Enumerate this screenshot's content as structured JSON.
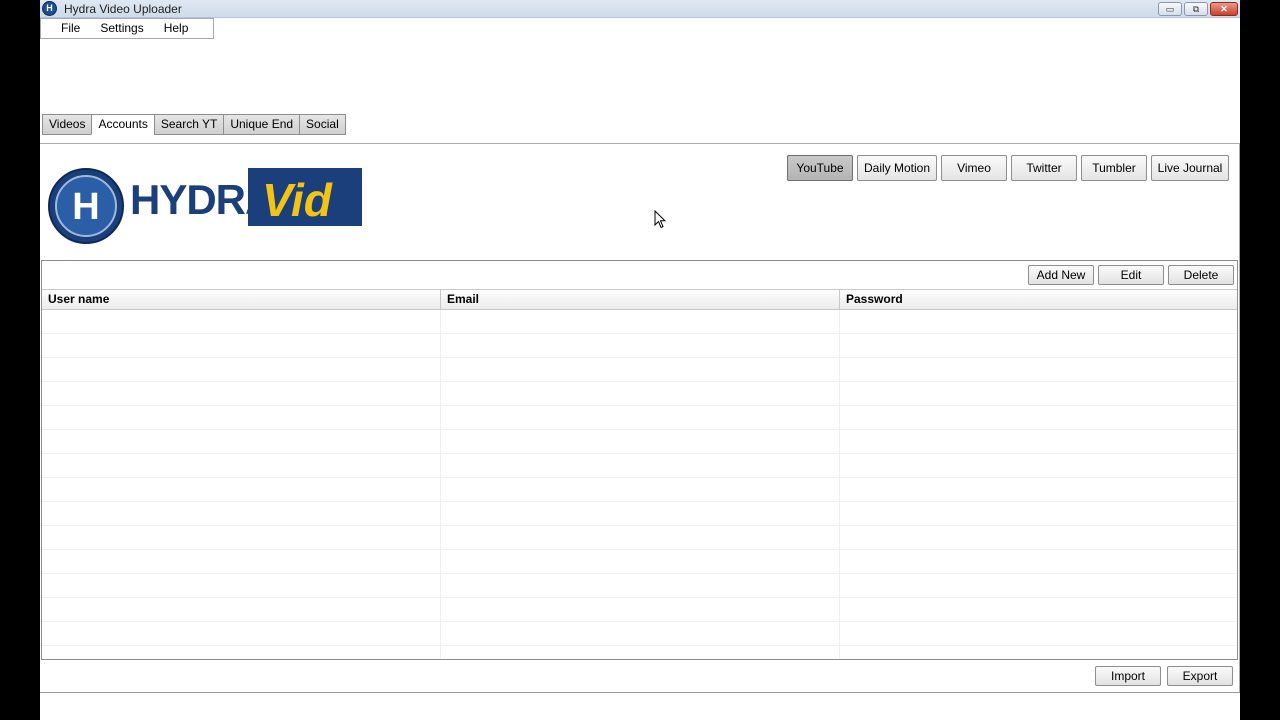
{
  "window": {
    "title": "Hydra Video Uploader",
    "minimize": "▭",
    "maximize": "⧉",
    "close": "✕",
    "app_icon": "H"
  },
  "menu": [
    "File",
    "Settings",
    "Help"
  ],
  "tabs": [
    {
      "label": "Videos",
      "active": false
    },
    {
      "label": "Accounts",
      "active": true
    },
    {
      "label": "Search YT",
      "active": false
    },
    {
      "label": "Unique End",
      "active": false
    },
    {
      "label": "Social",
      "active": false
    }
  ],
  "logo": {
    "text_main": "HYDRA",
    "text_accent": "Vid",
    "badge": "H",
    "colors": {
      "navy": "#1b3f7a",
      "yellow": "#f3c316"
    }
  },
  "services": [
    {
      "label": "YouTube",
      "active": true
    },
    {
      "label": "Daily Motion",
      "active": false
    },
    {
      "label": "Vimeo",
      "active": false
    },
    {
      "label": "Twitter",
      "active": false
    },
    {
      "label": "Tumbler",
      "active": false
    },
    {
      "label": "Live Journal",
      "active": false
    }
  ],
  "actions": {
    "add_new": "Add New",
    "edit": "Edit",
    "delete": "Delete"
  },
  "table": {
    "columns": [
      "User name",
      "Email",
      "Password"
    ],
    "rows": []
  },
  "footer": {
    "import": "Import",
    "export": "Export"
  }
}
